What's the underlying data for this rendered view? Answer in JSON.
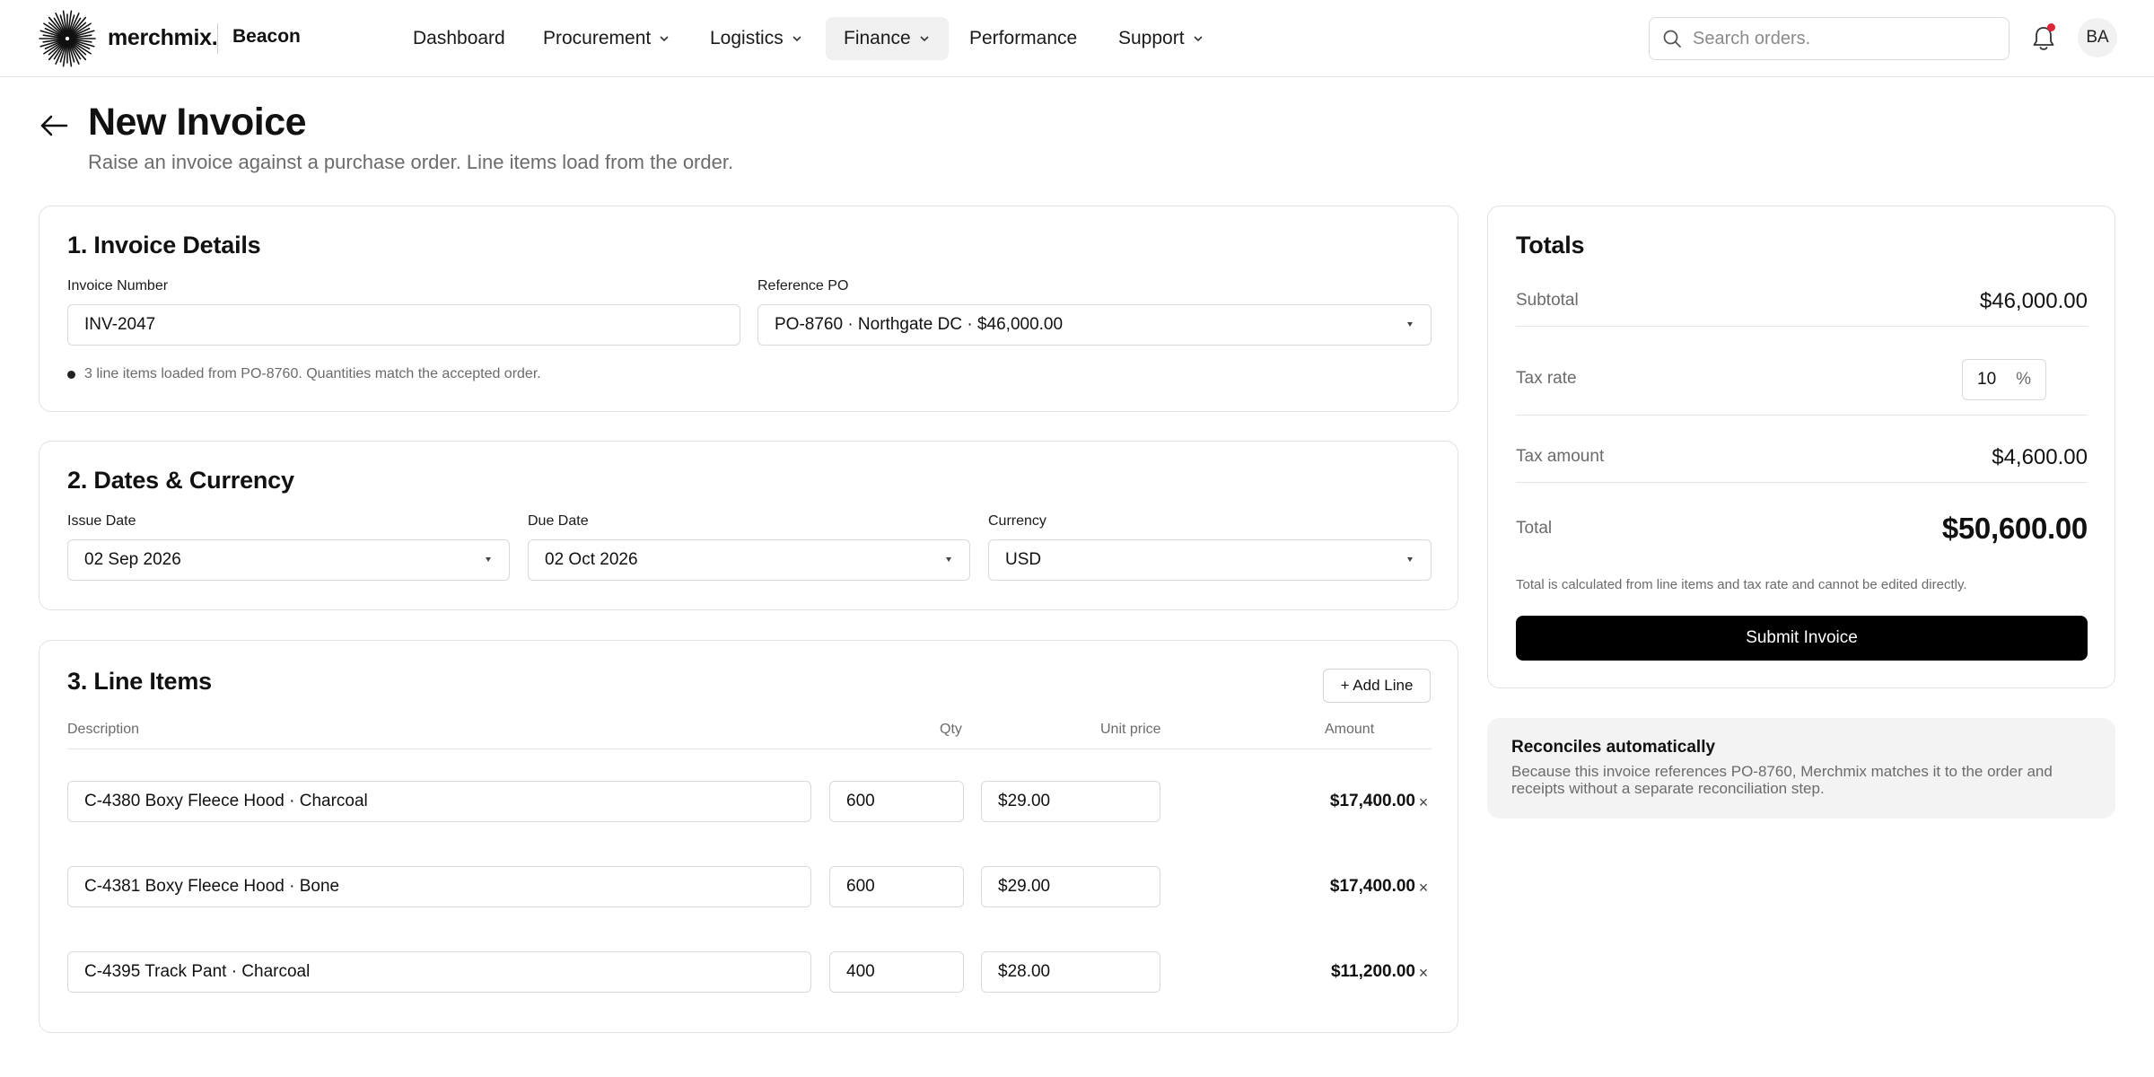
{
  "topbar": {
    "brand": "merchmix.",
    "workspace": "Beacon",
    "nav": [
      {
        "label": "Dashboard",
        "has_menu": false,
        "active": false
      },
      {
        "label": "Procurement",
        "has_menu": true,
        "active": false
      },
      {
        "label": "Logistics",
        "has_menu": true,
        "active": false
      },
      {
        "label": "Finance",
        "has_menu": true,
        "active": true
      },
      {
        "label": "Performance",
        "has_menu": false,
        "active": false
      },
      {
        "label": "Support",
        "has_menu": true,
        "active": false
      }
    ],
    "search_placeholder": "Search orders.",
    "avatar_initials": "BA",
    "notification_color": "#e0243a"
  },
  "header": {
    "title": "New Invoice",
    "subtitle": "Raise an invoice against a purchase order. Line items load from the order."
  },
  "details": {
    "title": "1. Invoice Details",
    "invoice_number_label": "Invoice Number",
    "invoice_number_value": "INV-2047",
    "reference_po_label": "Reference PO",
    "reference_po_value": "PO-8760 · Northgate DC · $46,000.00",
    "note": "3 line items loaded from PO-8760. Quantities match the accepted order."
  },
  "dates": {
    "title": "2. Dates & Currency",
    "issue_label": "Issue Date",
    "issue_value": "02 Sep 2026",
    "due_label": "Due Date",
    "due_value": "02 Oct 2026",
    "currency_label": "Currency",
    "currency_value": "USD"
  },
  "lines": {
    "title": "3. Line Items",
    "add_label": "+ Add Line",
    "headers": {
      "description": "Description",
      "qty": "Qty",
      "unit_price": "Unit price",
      "amount": "Amount"
    },
    "items": [
      {
        "description": "C-4380 Boxy Fleece Hood · Charcoal",
        "qty": "600",
        "unit_price": "$29.00",
        "amount": "$17,400.00"
      },
      {
        "description": "C-4381 Boxy Fleece Hood · Bone",
        "qty": "600",
        "unit_price": "$29.00",
        "amount": "$17,400.00"
      },
      {
        "description": "C-4395 Track Pant · Charcoal",
        "qty": "400",
        "unit_price": "$28.00",
        "amount": "$11,200.00"
      }
    ],
    "remove_glyph": "×"
  },
  "totals": {
    "title": "Totals",
    "subtotal_label": "Subtotal",
    "subtotal_value": "$46,000.00",
    "tax_rate_label": "Tax rate",
    "tax_rate_value": "10",
    "tax_rate_unit": "%",
    "tax_amount_label": "Tax amount",
    "tax_amount_value": "$4,600.00",
    "total_label": "Total",
    "total_value": "$50,600.00",
    "note": "Total is calculated from line items and tax rate and cannot be edited directly.",
    "submit_label": "Submit Invoice"
  },
  "reconcile": {
    "title": "Reconciles automatically",
    "body": "Because this invoice references PO-8760, Merchmix matches it to the order and receipts without a separate reconciliation step."
  }
}
